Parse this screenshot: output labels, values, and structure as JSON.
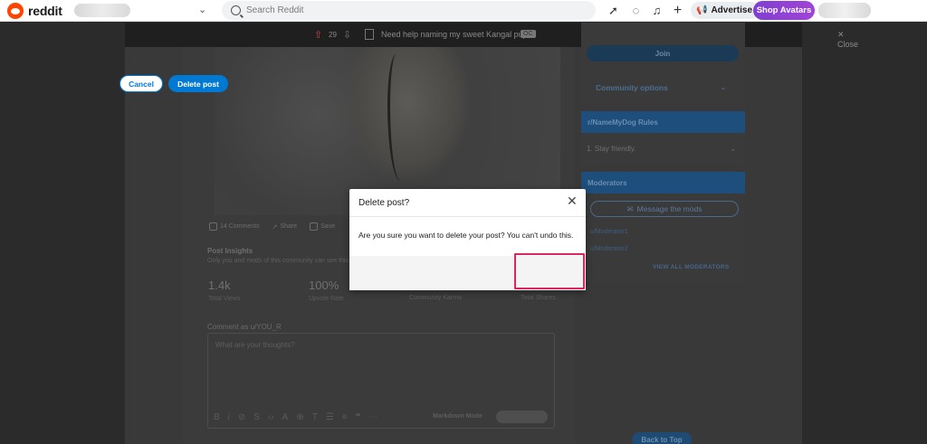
{
  "header": {
    "logo_text": "reddit",
    "search_placeholder": "Search Reddit",
    "advertise_label": "Advertise",
    "shop_avatars_label": "Shop Avatars"
  },
  "postbar": {
    "vote_count": "29",
    "title": "Need help naming my sweet Kangal pup!",
    "flair": "OC",
    "close_label": "Close"
  },
  "post": {
    "actions": [
      "14 Comments",
      "Share",
      "Save"
    ],
    "insights_title": "Post Insights",
    "insights_sub": "Only you and mods of this community can see this",
    "stats": [
      {
        "value": "1.4k",
        "label": "Total Views"
      },
      {
        "value": "100%",
        "label": "Upvote Rate"
      },
      {
        "value": "",
        "label": "Community Karma"
      },
      {
        "value": "",
        "label": "Total Shares"
      }
    ],
    "comment_as": "Comment as u/YOU_R",
    "comment_placeholder": "What are your thoughts?",
    "markdown_mode": "Markdown Mode"
  },
  "sidebar": {
    "join_label": "Join",
    "community_options": "Community options",
    "rules_header": "r/NameMyDog Rules",
    "rule_1": "1. Stay friendly.",
    "moderators_header": "Moderators",
    "message_mods": "Message the mods",
    "mod_1": "u/Moderator1",
    "mod_2": "u/Moderator2",
    "view_all_mods": "VIEW ALL MODERATORS",
    "back_to_top": "Back to Top"
  },
  "modal": {
    "title": "Delete post?",
    "body": "Are you sure you want to delete your post? You can't undo this.",
    "cancel_label": "Cancel",
    "delete_label": "Delete post"
  },
  "colors": {
    "accent": "#0079d3",
    "brand": "#ff4500",
    "highlight": "#e0245e"
  }
}
